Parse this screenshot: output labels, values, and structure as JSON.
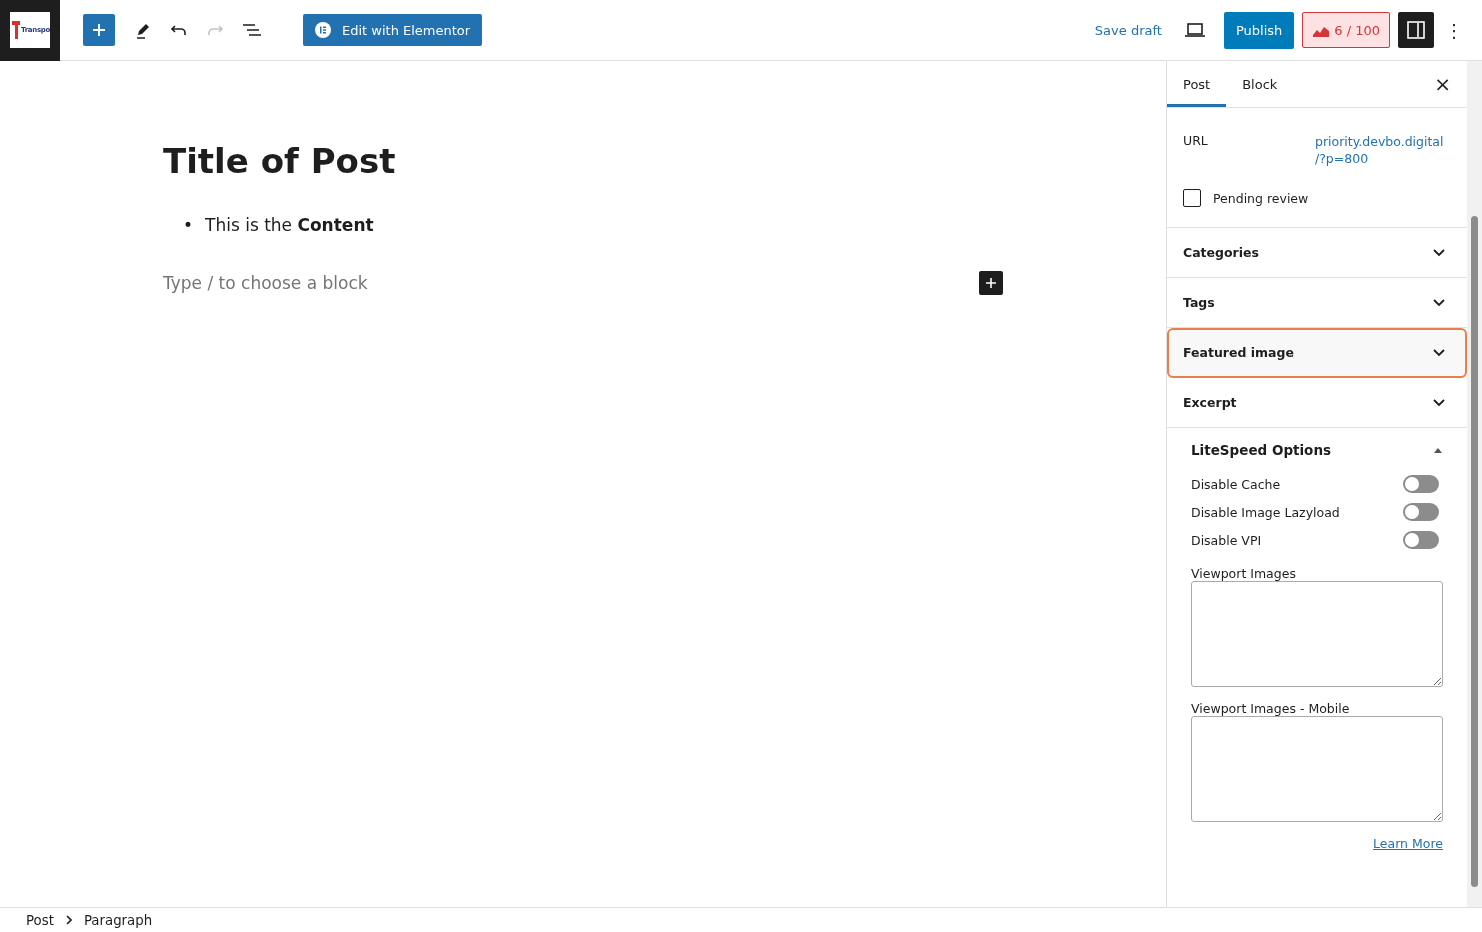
{
  "toolbar": {
    "logo_text": "Transpo",
    "elementor_button": "Edit with Elementor",
    "save_draft": "Save draft",
    "publish": "Publish",
    "seo_score": "6 / 100",
    "more": "⋮"
  },
  "editor": {
    "title": "Title of Post",
    "list_items": [
      {
        "marker": "•",
        "text": "This is the **Content**"
      }
    ],
    "placeholder": "Type / to choose a block"
  },
  "sidebar": {
    "tabs": [
      {
        "label": "Post",
        "selected": true
      },
      {
        "label": "Block",
        "selected": false
      }
    ],
    "close": "×",
    "url_label": "URL",
    "url_value": "priority.devbo.digital /?p=800",
    "pending_review": {
      "label": "Pending review",
      "checked": false
    },
    "panels": [
      {
        "title": "Categories",
        "highlighted": false
      },
      {
        "title": "Tags",
        "highlighted": false
      },
      {
        "title": "Featured image",
        "highlighted": true
      },
      {
        "title": "Excerpt",
        "highlighted": false
      }
    ],
    "litespeed": {
      "title": "LiteSpeed Options",
      "expanded": true,
      "toggles": [
        {
          "label": "Disable Cache",
          "on": false
        },
        {
          "label": "Disable Image Lazyload",
          "on": false
        },
        {
          "label": "Disable VPI",
          "on": false
        }
      ],
      "fields": [
        {
          "label": "Viewport Images"
        },
        {
          "label": "Viewport Images - Mobile"
        }
      ],
      "learn_more": "Learn More"
    }
  },
  "breadcrumb": [
    "Post",
    "Paragraph"
  ]
}
